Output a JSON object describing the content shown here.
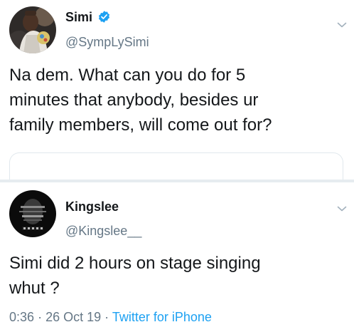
{
  "tweets": [
    {
      "author_name": "Simi",
      "verified": true,
      "handle": "@SympLySimi",
      "text": "Na dem. What can you do for 5\nminutes that anybody, besides ur\nfamily members, will come out for?"
    },
    {
      "author_name": "Kingslee",
      "verified": false,
      "handle": "@Kingslee__",
      "text": "Simi did 2 hours on stage singing\nwhut ?",
      "time": "0:36",
      "separator": "·",
      "date": "26 Oct 19",
      "source": "Twitter for iPhone"
    }
  ],
  "icons": {
    "verified": "verified-badge-icon",
    "menu": "chevron-down-icon"
  },
  "colors": {
    "text": "#14171a",
    "secondary": "#657786",
    "link": "#1da1f2",
    "divider": "#e6ecf0"
  }
}
